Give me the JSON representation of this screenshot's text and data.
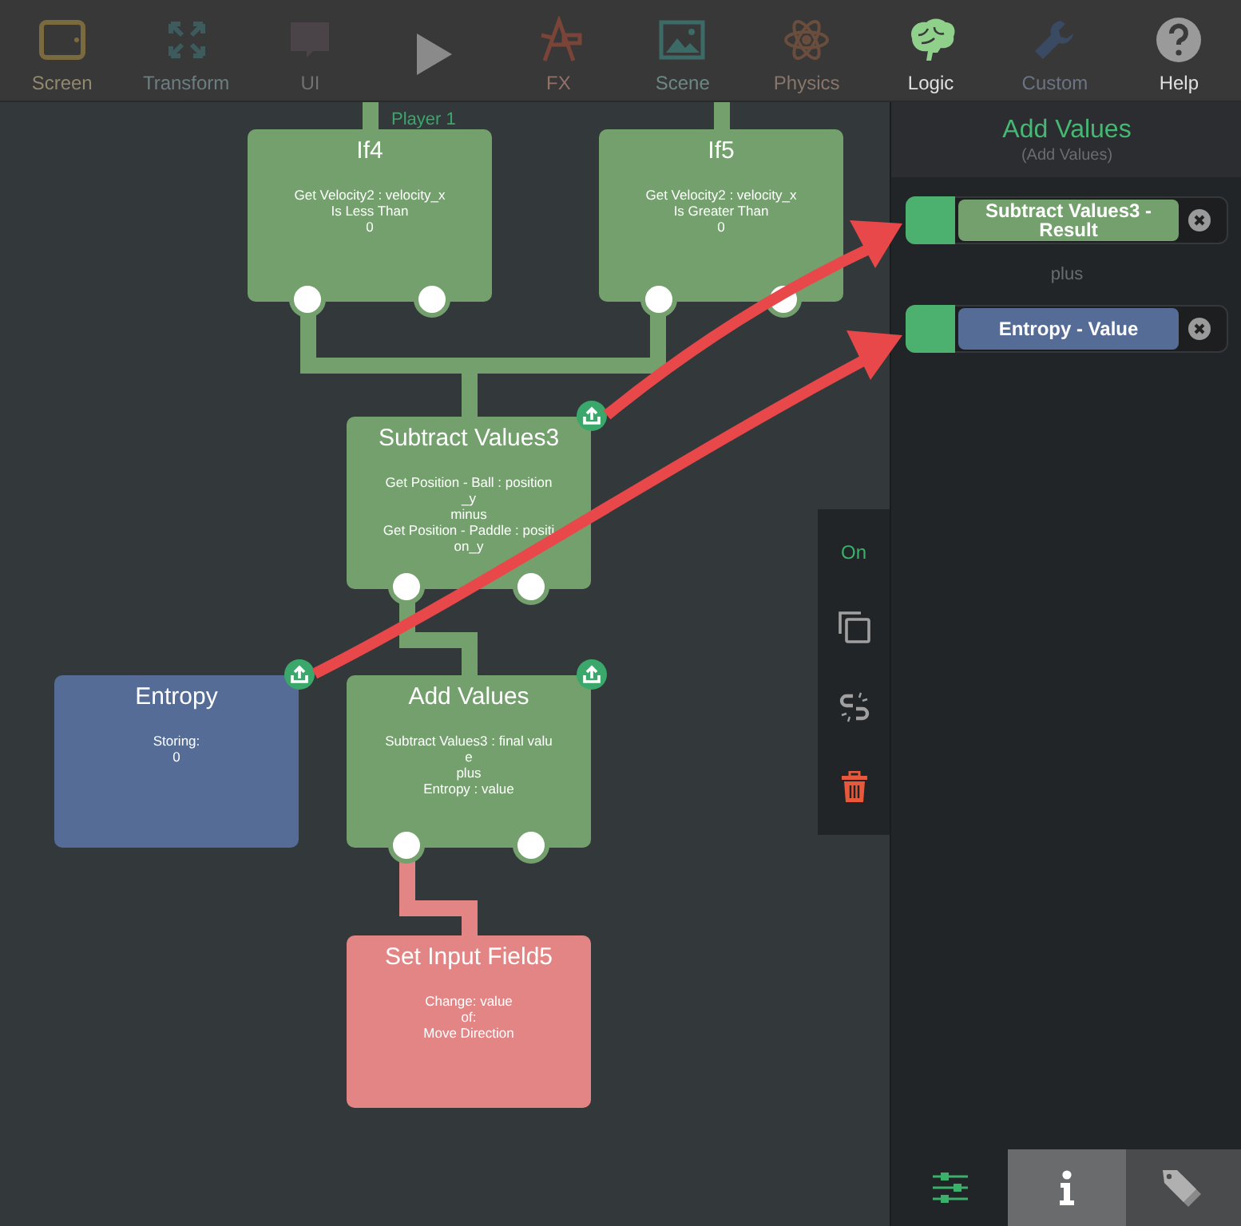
{
  "toolbar": [
    {
      "kind": "screen",
      "label": "Screen",
      "color": "#7a6a3e",
      "disabled": true
    },
    {
      "kind": "transform",
      "label": "Transform",
      "color": "#3d5a5d",
      "disabled": true
    },
    {
      "kind": "ui",
      "label": "UI",
      "color": "#4a4448",
      "disabled": true
    },
    {
      "kind": "play",
      "color": "#8a8a8a"
    },
    {
      "kind": "fx",
      "label": "FX",
      "color": "#7a4538",
      "disabled": true
    },
    {
      "kind": "scene",
      "label": "Scene",
      "color": "#3c6a66",
      "disabled": true
    },
    {
      "kind": "physics",
      "label": "Physics",
      "color": "#6a4d3c",
      "disabled": true
    },
    {
      "kind": "logic",
      "label": "Logic",
      "color": "#8fd08a",
      "disabled": false
    },
    {
      "kind": "custom",
      "label": "Custom",
      "color": "#3a4a62",
      "disabled": true
    },
    {
      "kind": "help",
      "label": "Help",
      "color": "#9a9a9a",
      "disabled": false
    }
  ],
  "canvas": {
    "label": "Player 1",
    "nodes": [
      {
        "kind": "condition",
        "title": "If4",
        "lines": [
          "Get Velocity2 : velocity_x",
          "Is Less Than",
          "0"
        ],
        "color": "#74a06d"
      },
      {
        "kind": "condition",
        "title": "If5",
        "lines": [
          "Get Velocity2 : velocity_x",
          "Is Greater Than",
          "0"
        ],
        "color": "#74a06d"
      },
      {
        "kind": "math",
        "title": "Subtract Values3",
        "lines": [
          "Get Position - Ball : position",
          "_y",
          "minus",
          "Get Position - Paddle : positi",
          "on_y"
        ],
        "color": "#74a06d"
      },
      {
        "kind": "variable",
        "title": "Entropy",
        "lines": [
          "Storing:",
          "0"
        ],
        "color": "#546c96"
      },
      {
        "kind": "math",
        "title": "Add Values",
        "lines": [
          "Subtract Values3 : final valu",
          "e",
          "plus",
          "Entropy : value"
        ],
        "color": "#74a06d"
      },
      {
        "kind": "action",
        "title": "Set Input Field5",
        "lines": [
          "Change: value",
          "of:",
          "Move Direction"
        ],
        "color": "#e38585"
      }
    ]
  },
  "node_actions": [
    {
      "kind": "toggle",
      "label": "On"
    },
    {
      "kind": "copy"
    },
    {
      "kind": "unlink"
    },
    {
      "kind": "delete"
    }
  ],
  "inspector": {
    "title": "Add Values",
    "subtitle": "(Add Values)",
    "inputs": [
      {
        "text": "Subtract Values3 - Result",
        "color": "#74a06d"
      },
      {
        "text": "Entropy - Value",
        "color": "#546c96"
      }
    ],
    "operator": "plus",
    "tabs": [
      {
        "kind": "settings",
        "selected": false
      },
      {
        "kind": "info",
        "selected": true
      },
      {
        "kind": "tags",
        "selected": false
      }
    ]
  }
}
